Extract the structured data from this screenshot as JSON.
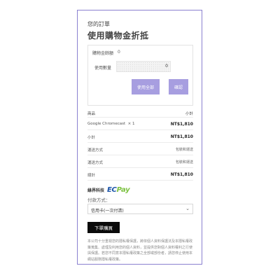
{
  "order": {
    "title": "您的訂單"
  },
  "coupon": {
    "title": "使用購物金折抵",
    "amount_label": "購物金餘額",
    "amount_value": "0",
    "qty_label": "使用數量",
    "qty_value": "0",
    "use_all_label": "使用全部",
    "confirm_label": "確認"
  },
  "table": {
    "header_product": "商品",
    "header_subtotal": "小計",
    "item_name": "Google Chromecast",
    "item_qty": "× 1",
    "item_price": "NT$1,810",
    "subtotal_label": "小計",
    "subtotal_value": "NT$1,810",
    "shipping1_label": "運送方式",
    "shipping1_value": "包裝和運送",
    "shipping2_label": "運送方式",
    "shipping2_value": "包裝和運送",
    "total_label": "總計",
    "total_value": "NT$1,810"
  },
  "payment": {
    "provider_label": "綠界科技",
    "logo_text_ec": "EC",
    "logo_text_pay": "Pay",
    "method_label": "付款方式：",
    "method_value": "信用卡(一次付清)"
  },
  "place_order_label": "下單購買",
  "privacy_text": "本公司十分重視您的隱私權保護，將依個人資料保護法及本隱私權政策蒐集、處理及利用您的個人資料，並提供您對個人資料權利之行使與保護。若您不同意本隱私權政策之全部或部份者，請您停止使用本網站服務隱私權政策。"
}
